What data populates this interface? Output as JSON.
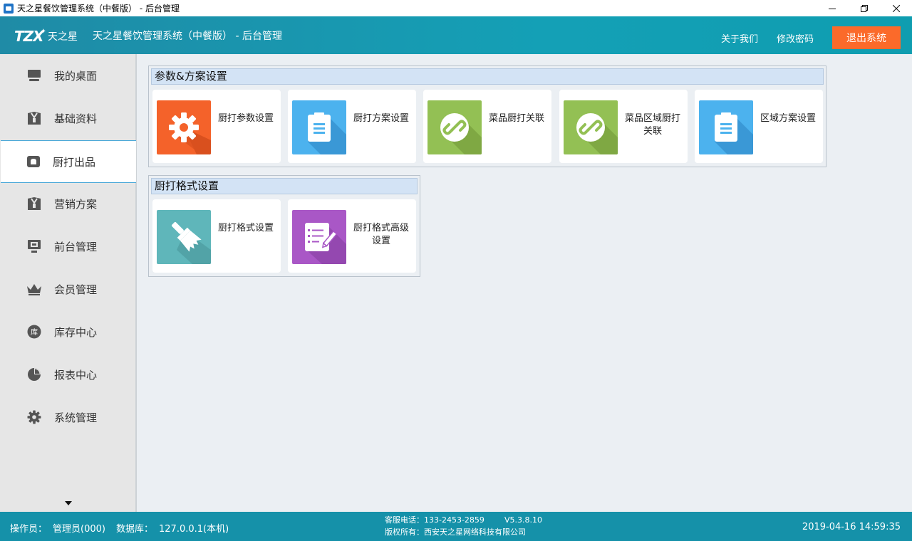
{
  "window": {
    "title": "天之星餐饮管理系统（中餐版） - 后台管理"
  },
  "header": {
    "logo_mark": "TZX",
    "logo_brand": "天之星",
    "title": "天之星餐饮管理系统（中餐版） - 后台管理",
    "about": "关于我们",
    "change_password": "修改密码",
    "logout": "退出系统"
  },
  "sidebar": {
    "items": [
      {
        "label": "我的桌面",
        "icon": "monitor-icon"
      },
      {
        "label": "基础资料",
        "icon": "box-icon"
      },
      {
        "label": "厨打出品",
        "icon": "chef-hat-icon",
        "active": true
      },
      {
        "label": "营销方案",
        "icon": "box-icon"
      },
      {
        "label": "前台管理",
        "icon": "screen-icon"
      },
      {
        "label": "会员管理",
        "icon": "crown-icon"
      },
      {
        "label": "库存中心",
        "icon": "warehouse-icon"
      },
      {
        "label": "报表中心",
        "icon": "pie-chart-icon"
      },
      {
        "label": "系统管理",
        "icon": "gear-icon"
      }
    ]
  },
  "sections": [
    {
      "title": "参数&方案设置",
      "tiles": [
        {
          "label": "厨打参数设置",
          "icon": "gear-icon",
          "color": "#f4622a"
        },
        {
          "label": "厨打方案设置",
          "icon": "clipboard-icon",
          "color": "#4cb2ee"
        },
        {
          "label": "菜品厨打关联",
          "icon": "link-icon",
          "color": "#93c054"
        },
        {
          "label": "菜品区域厨打关联",
          "icon": "link-icon",
          "color": "#93c054"
        },
        {
          "label": "区域方案设置",
          "icon": "clipboard-icon",
          "color": "#4cb2ee"
        }
      ]
    },
    {
      "title": "厨打格式设置",
      "tiles": [
        {
          "label": "厨打格式设置",
          "icon": "brush-icon",
          "color": "#5fb6ba"
        },
        {
          "label": "厨打格式高级设置",
          "icon": "checklist-icon",
          "color": "#a957c6"
        }
      ]
    }
  ],
  "footer": {
    "operator_label": "操作员：",
    "operator": "管理员(000)",
    "db_label": "数据库：",
    "db": "127.0.0.1(本机)",
    "service_phone": "客服电话：133-2453-2859",
    "version": "V5.3.8.10",
    "copyright": "版权所有：西安天之星网络科技有限公司",
    "datetime": "2019-04-16 14:59:35"
  }
}
